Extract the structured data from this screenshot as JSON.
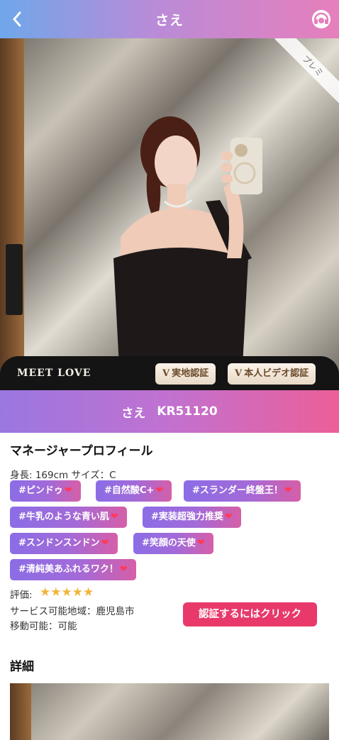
{
  "header": {
    "title": "さえ"
  },
  "photo": {
    "ribbon_text": "プレミ",
    "meet_love": "MEET LOVE"
  },
  "badges": [
    {
      "v": "V",
      "label": "実地認証"
    },
    {
      "v": "V",
      "label": "本人ビデオ認証"
    }
  ],
  "profile": {
    "name": "さえ",
    "id": "KR51120"
  },
  "manager": {
    "title": "マネージャープロフィール",
    "stats": "身長: 169cm サイズ：C",
    "tags": [
      "#ピンドゥ",
      "#自然酸C+",
      "#スランダー終盤王！",
      "#牛乳のような青い肌",
      "#実装超強力推奨",
      "#スンドンスンドン",
      "#笑顔の天使",
      "#清純美あふれるワク！"
    ],
    "rating_label": "評価:",
    "rating": 5,
    "stars": "★★★★★",
    "area": "サービス可能地域：鹿児島市",
    "travel": "移動可能：可能",
    "verify_button": "認証するにはクリック"
  },
  "details": {
    "title": "詳細"
  },
  "icons": {
    "back": "chevron-left-icon",
    "support": "headset-icon",
    "heart": "heart-icon",
    "star": "star-icon"
  },
  "colors": {
    "accent": "#e8396a",
    "tag_start": "#8b6de6",
    "tag_end": "#d65fa8"
  }
}
